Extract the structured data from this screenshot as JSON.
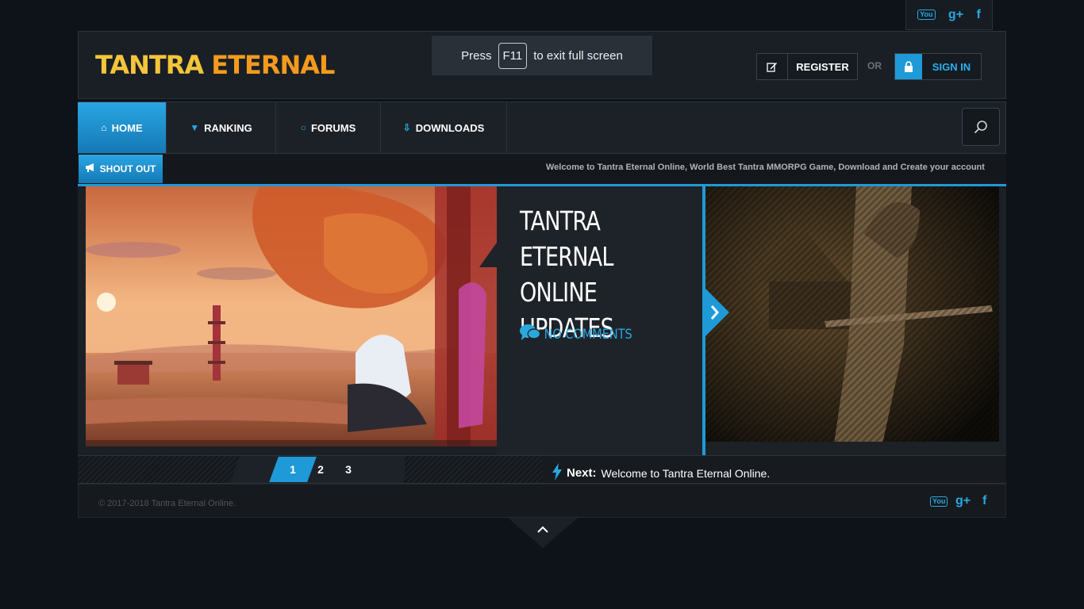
{
  "top_social": {
    "youtube": "You Tube",
    "google_plus": "g+",
    "facebook": "f"
  },
  "header": {
    "logo_part1": "TANTRA",
    "logo_part2": "ETERNAL",
    "fullscreen_prefix": "Press",
    "fullscreen_key": "F11",
    "fullscreen_suffix": "to exit full screen",
    "register_label": "REGISTER",
    "or_label": "OR",
    "signin_label": "SIGN IN"
  },
  "nav": {
    "items": [
      {
        "label": "HOME",
        "icon": "home-icon"
      },
      {
        "label": "RANKING",
        "icon": "trophy-icon"
      },
      {
        "label": "FORUMS",
        "icon": "chat-icon"
      },
      {
        "label": "DOWNLOADS",
        "icon": "download-icon"
      }
    ]
  },
  "shoutout": {
    "label": "SHOUT OUT",
    "text": "Welcome to Tantra Eternal Online, World Best Tantra MMORPG Game, Download and Create your account"
  },
  "slider": {
    "title": "TANTRA ETERNAL ONLINE UPDATES",
    "comments": "NO COMMENTS",
    "pages": [
      "1",
      "2",
      "3"
    ],
    "active_page": "1",
    "next_label": "Next:",
    "next_text": "Welcome to Tantra Eternal Online."
  },
  "footer": {
    "copyright": "© 2017-2018 Tantra Eternal Online."
  },
  "colors": {
    "accent": "#1f9ad8",
    "logo_yellow": "#f3c53a",
    "logo_orange": "#f39a1e",
    "background": "#0d1318"
  }
}
